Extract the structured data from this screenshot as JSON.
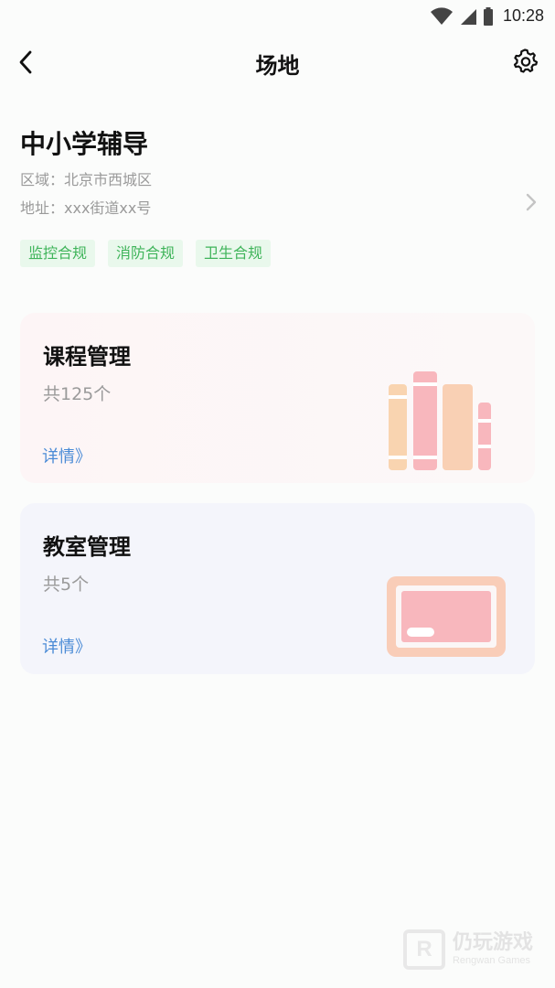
{
  "status": {
    "time": "10:28"
  },
  "nav": {
    "title": "场地"
  },
  "venue": {
    "name": "中小学辅导",
    "region_label": "区域：",
    "region_value": "北京市西城区",
    "address_label": "地址：",
    "address_value": "xxx街道xx号",
    "tags": [
      "监控合规",
      "消防合规",
      "卫生合规"
    ]
  },
  "cards": [
    {
      "title": "课程管理",
      "count": "共125个",
      "link": "详情》"
    },
    {
      "title": "教室管理",
      "count": "共5个",
      "link": "详情》"
    }
  ],
  "watermark": {
    "name": "仍玩游戏",
    "sub": "Rengwan Games"
  },
  "colors": {
    "tag_bg": "#e9f8ec",
    "tag_text": "#3fb45a",
    "link": "#4a8bd6",
    "book_pink": "#f8b7bd",
    "book_peach": "#f9d4b0"
  }
}
